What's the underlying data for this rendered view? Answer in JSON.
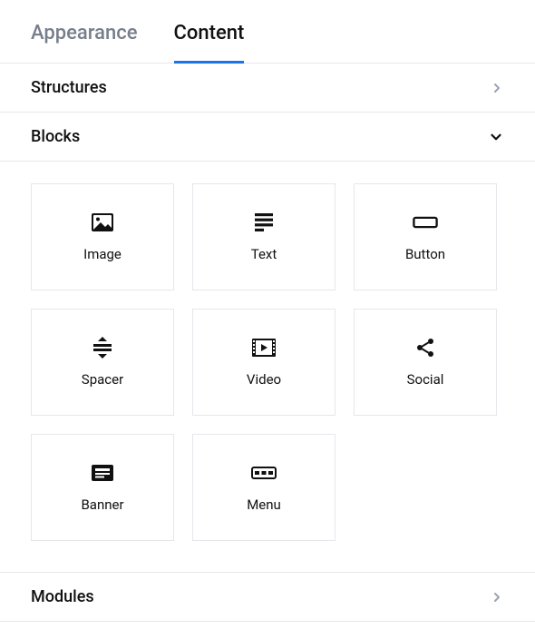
{
  "tabs": {
    "appearance": "Appearance",
    "content": "Content"
  },
  "sections": {
    "structures": "Structures",
    "blocks": "Blocks",
    "modules": "Modules"
  },
  "blocks": {
    "image": "Image",
    "text": "Text",
    "button": "Button",
    "spacer": "Spacer",
    "video": "Video",
    "social": "Social",
    "banner": "Banner",
    "menu": "Menu"
  }
}
